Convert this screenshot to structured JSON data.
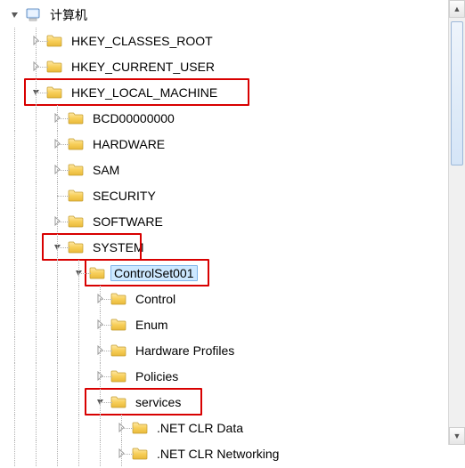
{
  "root": {
    "label": "计算机"
  },
  "hives": {
    "classes_root": "HKEY_CLASSES_ROOT",
    "current_user": "HKEY_CURRENT_USER",
    "local_machine": "HKEY_LOCAL_MACHINE"
  },
  "hklm": {
    "bcd": "BCD00000000",
    "hardware": "HARDWARE",
    "sam": "SAM",
    "security": "SECURITY",
    "software": "SOFTWARE",
    "system": "SYSTEM"
  },
  "system": {
    "controlset001": "ControlSet001"
  },
  "cs001": {
    "control": "Control",
    "enum": "Enum",
    "hwprofiles": "Hardware Profiles",
    "policies": "Policies",
    "services": "services"
  },
  "services": {
    "netclrdata": ".NET CLR Data",
    "netclrnet": ".NET CLR Networking"
  }
}
